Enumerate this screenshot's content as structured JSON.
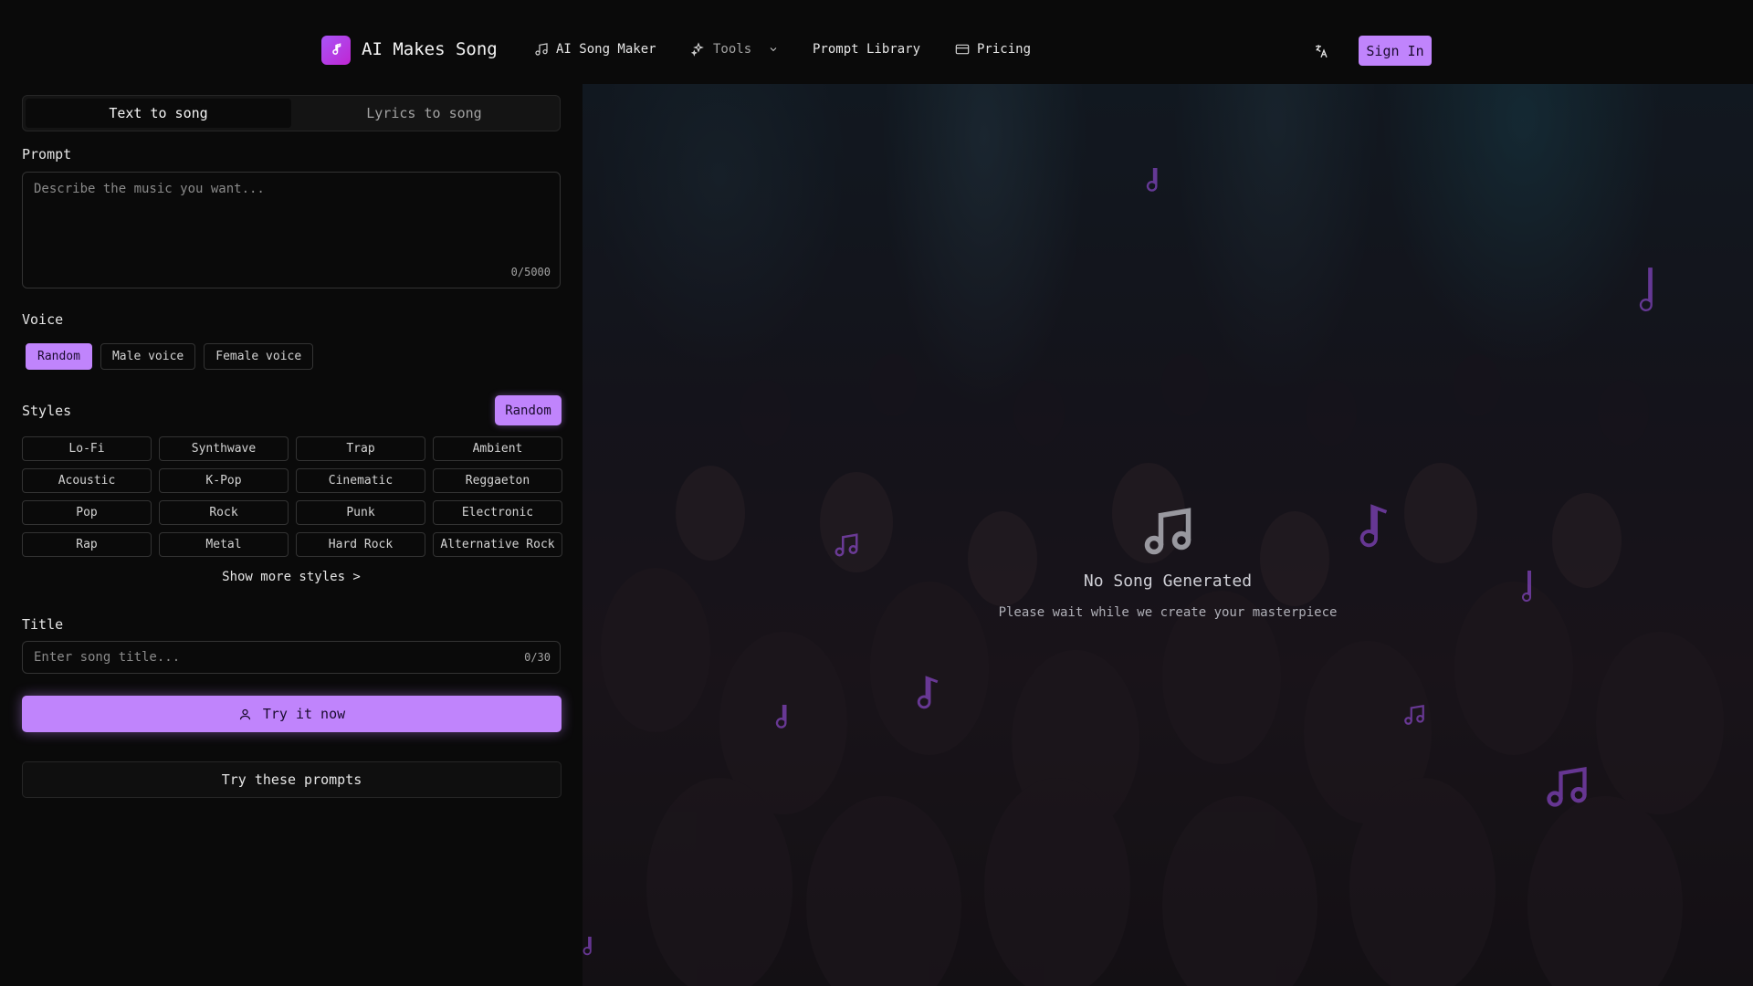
{
  "header": {
    "brand": "AI Makes Song",
    "nav": {
      "song_maker": "AI Song Maker",
      "tools": "Tools",
      "prompt_library": "Prompt Library",
      "pricing": "Pricing"
    },
    "sign_in": "Sign In"
  },
  "tabs": [
    {
      "label": "Text to song",
      "active": true
    },
    {
      "label": "Lyrics to song",
      "active": false
    }
  ],
  "prompt": {
    "label": "Prompt",
    "placeholder": "Describe the music you want...",
    "counter": "0/5000"
  },
  "voice": {
    "label": "Voice",
    "options": [
      "Random",
      "Male voice",
      "Female voice"
    ],
    "selected": "Random"
  },
  "styles": {
    "label": "Styles",
    "random_label": "Random",
    "items": [
      "Lo-Fi",
      "Synthwave",
      "Trap",
      "Ambient",
      "Acoustic",
      "K-Pop",
      "Cinematic",
      "Reggaeton",
      "Pop",
      "Rock",
      "Punk",
      "Electronic",
      "Rap",
      "Metal",
      "Hard Rock",
      "Alternative Rock"
    ],
    "show_more": "Show more styles >"
  },
  "title_field": {
    "label": "Title",
    "placeholder": "Enter song title...",
    "counter": "0/30"
  },
  "actions": {
    "try_now": "Try it now",
    "try_prompts": "Try these prompts"
  },
  "empty_state": {
    "title": "No Song Generated",
    "subtitle": "Please wait while we create your masterpiece"
  },
  "colors": {
    "accent": "#c084fc",
    "background": "#0a0a0a"
  }
}
